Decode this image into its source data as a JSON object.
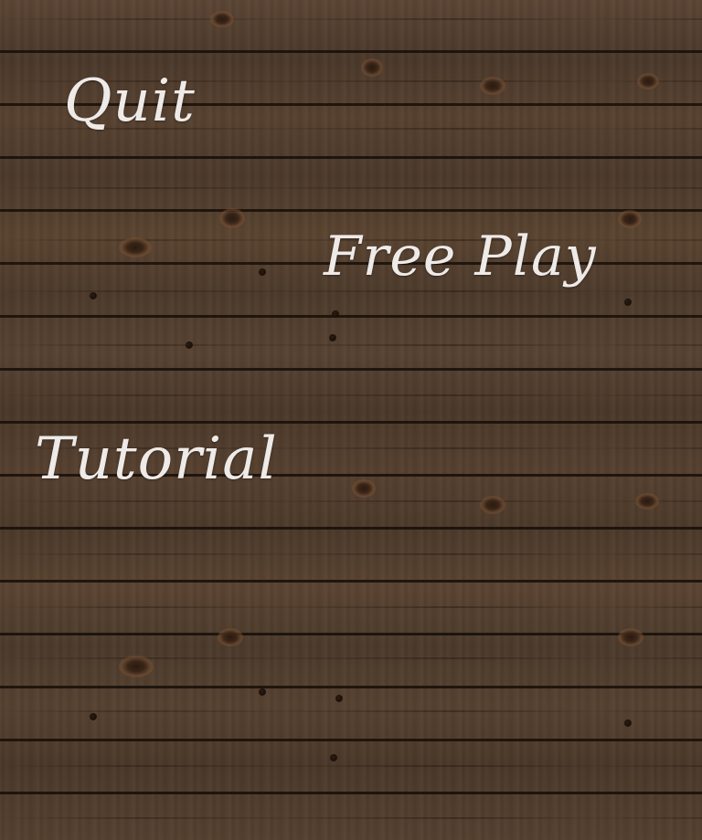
{
  "menu": {
    "quit_label": "Quit",
    "free_play_label": "Free Play",
    "tutorial_label": "Tutorial"
  },
  "colors": {
    "wood_base": "#4a3729",
    "label_text": "#eeeae8"
  }
}
